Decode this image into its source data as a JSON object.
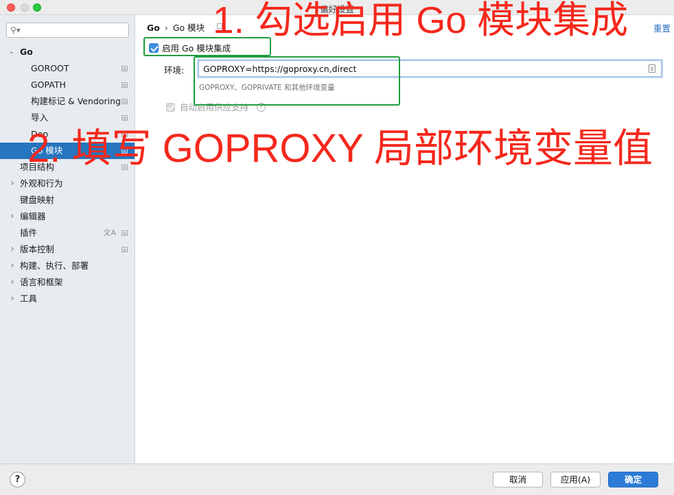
{
  "window": {
    "title": "偏好设置"
  },
  "sidebar": {
    "search_placeholder": "",
    "items": [
      {
        "label": "Go",
        "arrow": "⌄",
        "level": 0,
        "bold": true
      },
      {
        "label": "GOROOT",
        "level": 1
      },
      {
        "label": "GOPATH",
        "level": 1
      },
      {
        "label": "构建标记 & Vendoring",
        "level": 1
      },
      {
        "label": "导入",
        "level": 1
      },
      {
        "label": "Dep",
        "level": 1
      },
      {
        "label": "Go 模块",
        "level": 1,
        "selected": true
      },
      {
        "label": "项目结构",
        "level": 0
      },
      {
        "label": "外观和行为",
        "arrow": "›",
        "level": 0
      },
      {
        "label": "键盘映射",
        "level": 0
      },
      {
        "label": "编辑器",
        "arrow": "›",
        "level": 0
      },
      {
        "label": "插件",
        "level": 0
      },
      {
        "label": "版本控制",
        "arrow": "›",
        "level": 0
      },
      {
        "label": "构建、执行、部署",
        "arrow": "›",
        "level": 0
      },
      {
        "label": "语言和框架",
        "arrow": "›",
        "level": 0
      },
      {
        "label": "工具",
        "arrow": "›",
        "level": 0
      }
    ]
  },
  "main": {
    "breadcrumb": {
      "first": "Go",
      "separator": "›",
      "second": "Go 模块"
    },
    "reset_label": "重置",
    "enable_label": "启用 Go 模块集成",
    "enable_checked": true,
    "env_label": "环境:",
    "env_value": "GOPROXY=https://goproxy.cn,direct",
    "env_hint": "GOPROXY、GOPRIVATE 和其他环境变量",
    "vendoring_label": "自动启用供应支持",
    "vendoring_checked": true,
    "vendoring_enabled": false
  },
  "footer": {
    "help_label": "?",
    "cancel_label": "取消",
    "apply_label": "应用(A)",
    "ok_label": "确定"
  },
  "annotations": {
    "step1": "1. 勾选启用 Go 模块集成",
    "step2": "2. 填写 GOPROXY 局部环境变量值",
    "color": "#f5281c",
    "box_color": "#1f9d3c"
  },
  "colors": {
    "accent": "#2675bf",
    "ok_button": "#2c7bd6",
    "link": "#2a6fc0"
  }
}
